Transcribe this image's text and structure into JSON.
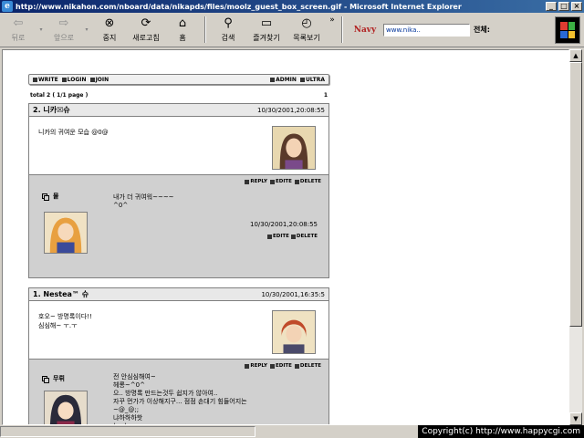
{
  "window": {
    "title": "http://www.nikahon.com/nboard/data/nikapds/files/moolz_guest_box_screen.gif - Microsoft Internet Explorer",
    "buttons": {
      "minimize": "_",
      "maximize": "□",
      "close": "×"
    }
  },
  "toolbar": {
    "back": "뒤로",
    "forward": "앞으로",
    "stop": "중지",
    "refresh": "새로고침",
    "home": "홈",
    "search": "검색",
    "favorites": "즐겨찾기",
    "history": "목록보기",
    "more": "»",
    "navy": "Navy",
    "address_value": "www.nika..",
    "all_label": "전체:"
  },
  "board": {
    "top_links_left": [
      "WRITE",
      "LOGIN",
      "JOIN"
    ],
    "top_links_right": [
      "ADMIN",
      "ULTRA"
    ],
    "total": "total 2 ( 1/1 page )",
    "page": "1",
    "posts": [
      {
        "name": "2. 니카☒슈",
        "date": "10/30/2001,20:08:55",
        "body": "니카의 귀여운 모습 @0@",
        "actions": [
          "REPLY",
          "EDITE",
          "DELETE"
        ],
        "reply": {
          "name": "물",
          "lines": [
            "내가 더 귀여워~~~~",
            "^0^"
          ],
          "date": "10/30/2001,20:08:55",
          "actions": [
            "EDITE",
            "DELETE"
          ]
        }
      },
      {
        "name": "1. Nestea™ 슈",
        "date": "10/30/2001,16:35:5",
        "body_lines": [
          "호오~ 방명록이다!!",
          "심심해~ ㅜ.ㅜ"
        ],
        "actions": [
          "REPLY",
          "EDITE",
          "DELETE"
        ],
        "reply": {
          "name": "무뤼",
          "lines": [
            "전 안심심해여~",
            "헤롱~^0^",
            "으.. 방명록 만드는것두 쉽지가 않아여..",
            "자꾸 먼가가 이상해지구... 점점 손대기 힘들어지는",
            "~@_@;;",
            "냐하하하핫",
            "( - -);;"
          ]
        }
      }
    ]
  },
  "statusbar": {
    "copyright": "Copyright(c) http://www.happycgi.com"
  },
  "colors": {
    "titlebar": "#0a246a",
    "chrome": "#d4d0c8",
    "reply_bg": "#d0d0d0"
  }
}
